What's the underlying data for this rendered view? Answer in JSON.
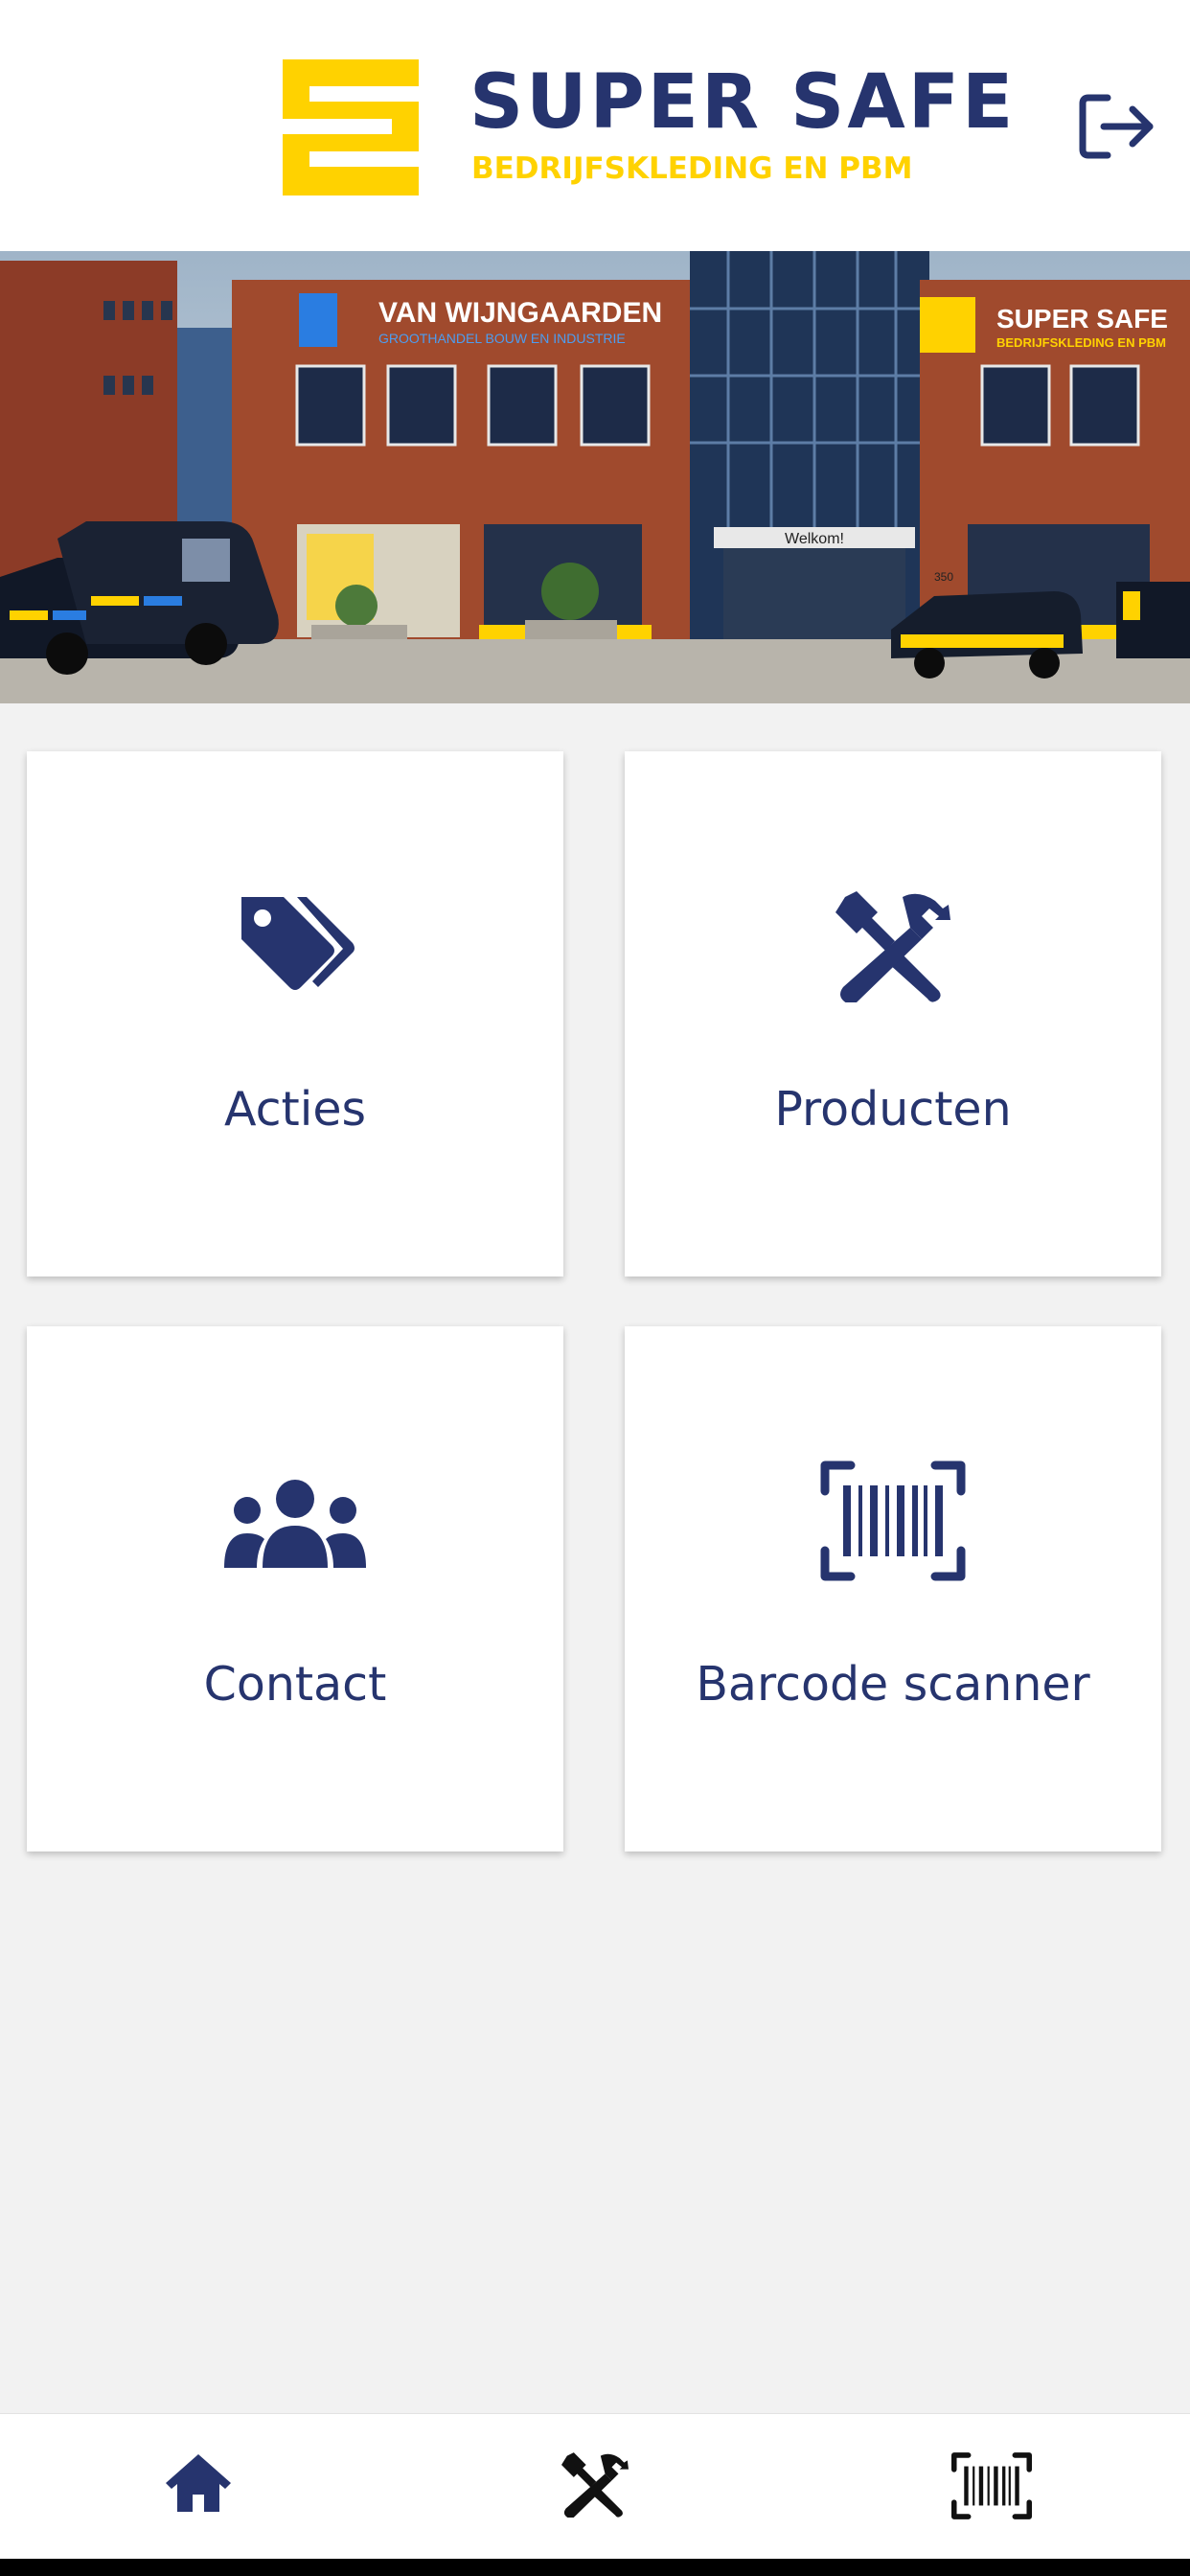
{
  "header": {
    "brand_name": "SUPER SAFE",
    "brand_tagline": "BEDRIJFSKLEDING EN PBM",
    "logout_icon": "logout-icon"
  },
  "hero": {
    "sign_left_title": "VAN WIJNGAARDEN",
    "sign_left_subtitle": "GROOTHANDEL BOUW EN INDUSTRIE",
    "sign_right_title": "SUPER SAFE",
    "sign_right_subtitle": "BEDRIJFSKLEDING EN PBM",
    "entrance_sign": "Welkom!",
    "house_number": "350"
  },
  "tiles": [
    {
      "label": "Acties",
      "icon": "tags-icon"
    },
    {
      "label": "Producten",
      "icon": "tools-icon"
    },
    {
      "label": "Contact",
      "icon": "users-icon"
    },
    {
      "label": "Barcode scanner",
      "icon": "barcode-icon"
    }
  ],
  "bottom_nav": [
    {
      "icon": "home-icon",
      "active": true
    },
    {
      "icon": "tools-icon",
      "active": false
    },
    {
      "icon": "barcode-icon",
      "active": false
    }
  ],
  "colors": {
    "primary": "#26346e",
    "accent": "#ffd200",
    "background": "#f2f2f2",
    "nav_icon": "#222222"
  }
}
